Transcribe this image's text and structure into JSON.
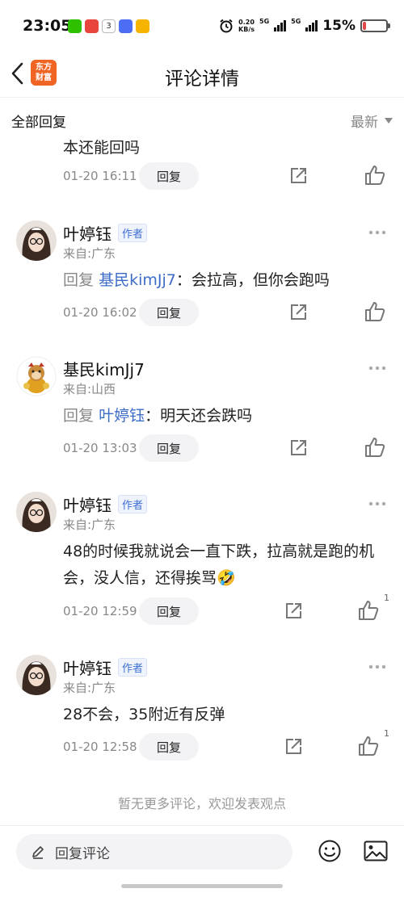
{
  "status_bar": {
    "time": "23:05",
    "net_speed_value": "0.20",
    "net_speed_unit": "KB/s",
    "signal_1": "5G",
    "signal_2": "5G",
    "battery_percent": "15%",
    "battery_level": 0.15
  },
  "header": {
    "logo_text_line1": "东方",
    "logo_text_line2": "财富",
    "title": "评论详情"
  },
  "sort_bar": {
    "all_replies": "全部回复",
    "sort_label": "最新"
  },
  "top_fragment": {
    "text": "本还能回吗",
    "time": "01-20 16:11",
    "reply_label": "回复"
  },
  "comments": [
    {
      "name": "叶婷钰",
      "badge": "作者",
      "location": "来自:广东",
      "reply_prefix": "回复",
      "reply_target": "基民kimJj7",
      "content": "：会拉高，但你会跑吗",
      "time": "01-20 16:02",
      "reply_label": "回复",
      "likes": ""
    },
    {
      "name": "基民kimJj7",
      "badge": "",
      "location": "来自:山西",
      "reply_prefix": "回复",
      "reply_target": "叶婷钰",
      "content": "：明天还会跌吗",
      "time": "01-20 13:03",
      "reply_label": "回复",
      "likes": ""
    },
    {
      "name": "叶婷钰",
      "badge": "作者",
      "location": "来自:广东",
      "content": "48的时候我就说会一直下跌，拉高就是跑的机会，没人信，还得挨骂🤣",
      "time": "01-20 12:59",
      "reply_label": "回复",
      "likes": "1"
    },
    {
      "name": "叶婷钰",
      "badge": "作者",
      "location": "来自:广东",
      "content": "28不会，35附近有反弹",
      "time": "01-20 12:58",
      "reply_label": "回复",
      "likes": "1"
    }
  ],
  "no_more_text": "暂无更多评论，欢迎发表观点",
  "bottom_bar": {
    "reply_placeholder": "回复评论"
  },
  "colors": {
    "brand": "#f06424",
    "link_blue": "#3d6cc7",
    "battery_low": "#e04848"
  },
  "icons": [
    "back-arrow-icon",
    "app-logo",
    "share-icon",
    "thumbs-up-icon",
    "more-dots-icon",
    "pencil-icon",
    "emoji-icon",
    "image-icon"
  ]
}
